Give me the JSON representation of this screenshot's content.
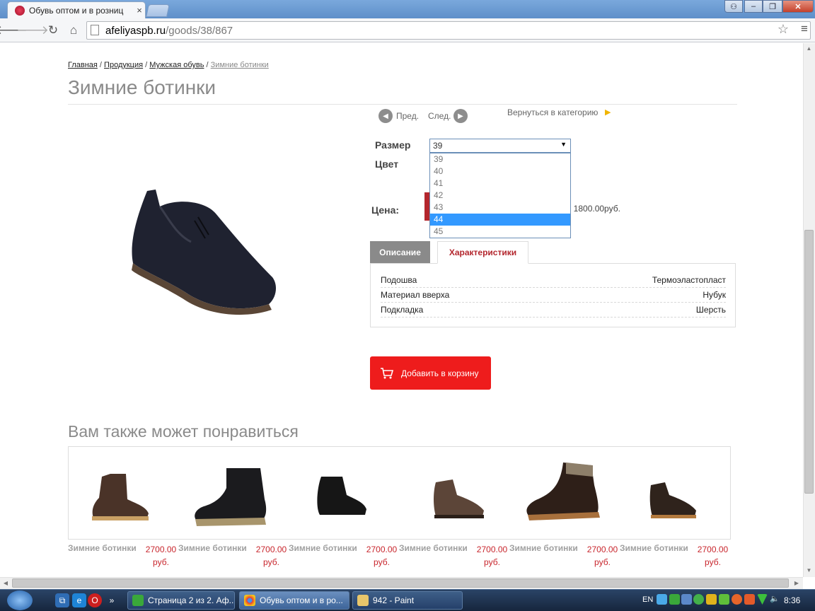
{
  "browser": {
    "tab_title": "Обувь оптом и в розниц",
    "close_glyph": "×",
    "url_host": "afeliyaspb.ru",
    "url_path": "/goods/38/867"
  },
  "breadcrumb": {
    "items": [
      "Главная",
      "Продукция",
      "Мужская обувь"
    ],
    "separator": " / ",
    "current": "Зимние ботинки"
  },
  "page_title": "Зимние ботинки",
  "nav": {
    "prev": "Пред.",
    "next": "След.",
    "back": "Вернуться в категорию"
  },
  "options": {
    "size_label": "Размер",
    "color_label": "Цвет",
    "size_selected": "39",
    "size_options": [
      "39",
      "40",
      "41",
      "42",
      "43",
      "44",
      "45"
    ],
    "highlighted": "44"
  },
  "price": {
    "label": "Цена:",
    "text": ": 1800.00руб."
  },
  "tabs": {
    "description": "Описание",
    "characteristics": "Характеристики"
  },
  "specs": [
    {
      "key": "Подошва",
      "value": "Термоэластопласт"
    },
    {
      "key": "Материал вверха",
      "value": "Нубук"
    },
    {
      "key": "Подкладка",
      "value": "Шерсть"
    }
  ],
  "add_to_cart": "Добавить в корзину",
  "related": {
    "title": "Вам также может понравиться",
    "items": [
      {
        "name": "Зимние ботинки",
        "price": "2700.00",
        "currency": "руб."
      },
      {
        "name": "Зимние ботинки",
        "price": "2700.00",
        "currency": "руб."
      },
      {
        "name": "Зимние ботинки",
        "price": "2700.00",
        "currency": "руб."
      },
      {
        "name": "Зимние ботинки",
        "price": "2700.00",
        "currency": "руб."
      },
      {
        "name": "Зимние ботинки",
        "price": "2700.00",
        "currency": "руб."
      },
      {
        "name": "Зимние ботинки",
        "price": "2700.00",
        "currency": "руб."
      }
    ]
  },
  "taskbar": {
    "tasks": [
      {
        "label": "Страница 2 из 2. Аф...",
        "icon": "green-a-icon"
      },
      {
        "label": "Обувь оптом и в ро...",
        "icon": "chrome-icon"
      },
      {
        "label": "942 - Paint",
        "icon": "paint-icon"
      }
    ],
    "lang": "EN",
    "clock": "8:36"
  },
  "colors": {
    "accent_red": "#ee1c1c",
    "tab_red": "#b3262d",
    "price_red": "#c8262d",
    "title_gray": "#8a8a8a",
    "select_highlight": "#3399ff"
  }
}
